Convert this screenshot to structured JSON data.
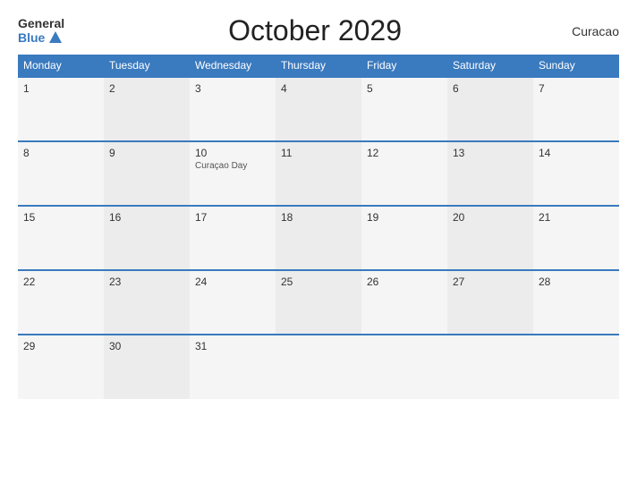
{
  "header": {
    "logo_general": "General",
    "logo_blue": "Blue",
    "title": "October 2029",
    "country": "Curacao"
  },
  "weekdays": [
    "Monday",
    "Tuesday",
    "Wednesday",
    "Thursday",
    "Friday",
    "Saturday",
    "Sunday"
  ],
  "weeks": [
    [
      {
        "day": "1",
        "event": ""
      },
      {
        "day": "2",
        "event": ""
      },
      {
        "day": "3",
        "event": ""
      },
      {
        "day": "4",
        "event": ""
      },
      {
        "day": "5",
        "event": ""
      },
      {
        "day": "6",
        "event": ""
      },
      {
        "day": "7",
        "event": ""
      }
    ],
    [
      {
        "day": "8",
        "event": ""
      },
      {
        "day": "9",
        "event": ""
      },
      {
        "day": "10",
        "event": "Curaçao Day"
      },
      {
        "day": "11",
        "event": ""
      },
      {
        "day": "12",
        "event": ""
      },
      {
        "day": "13",
        "event": ""
      },
      {
        "day": "14",
        "event": ""
      }
    ],
    [
      {
        "day": "15",
        "event": ""
      },
      {
        "day": "16",
        "event": ""
      },
      {
        "day": "17",
        "event": ""
      },
      {
        "day": "18",
        "event": ""
      },
      {
        "day": "19",
        "event": ""
      },
      {
        "day": "20",
        "event": ""
      },
      {
        "day": "21",
        "event": ""
      }
    ],
    [
      {
        "day": "22",
        "event": ""
      },
      {
        "day": "23",
        "event": ""
      },
      {
        "day": "24",
        "event": ""
      },
      {
        "day": "25",
        "event": ""
      },
      {
        "day": "26",
        "event": ""
      },
      {
        "day": "27",
        "event": ""
      },
      {
        "day": "28",
        "event": ""
      }
    ],
    [
      {
        "day": "29",
        "event": ""
      },
      {
        "day": "30",
        "event": ""
      },
      {
        "day": "31",
        "event": ""
      },
      {
        "day": "",
        "event": ""
      },
      {
        "day": "",
        "event": ""
      },
      {
        "day": "",
        "event": ""
      },
      {
        "day": "",
        "event": ""
      }
    ]
  ]
}
